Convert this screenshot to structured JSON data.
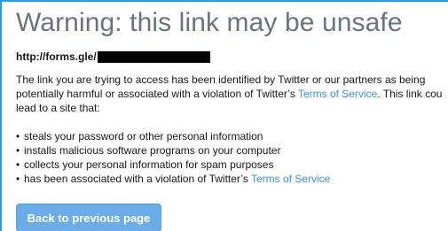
{
  "page": {
    "title": "Warning: this link may be unsafe",
    "url_prefix": "http://forms.gle/",
    "paragraph": {
      "line1": "The link you are trying to access has been identified by Twitter or our partners as being",
      "line2_before": "potentially harmful or associated with a violation of Twitter’s ",
      "line2_link": "Terms of Service",
      "line2_after": ". This link cou",
      "line3": "lead to a site that:"
    },
    "bullets": [
      {
        "text": "steals your password or other personal information"
      },
      {
        "text": "installs malicious software programs on your computer"
      },
      {
        "text": "collects your personal information for spam purposes"
      },
      {
        "text_before": "has been associated with a violation of Twitter’s ",
        "link": "Terms of Service"
      }
    ],
    "back_button_label": "Back to previous page"
  },
  "colors": {
    "accent_border": "#1da1f2",
    "title": "#66757f",
    "link": "#3b94d9",
    "button_bg": "#6aace8",
    "redaction": "#000000"
  }
}
